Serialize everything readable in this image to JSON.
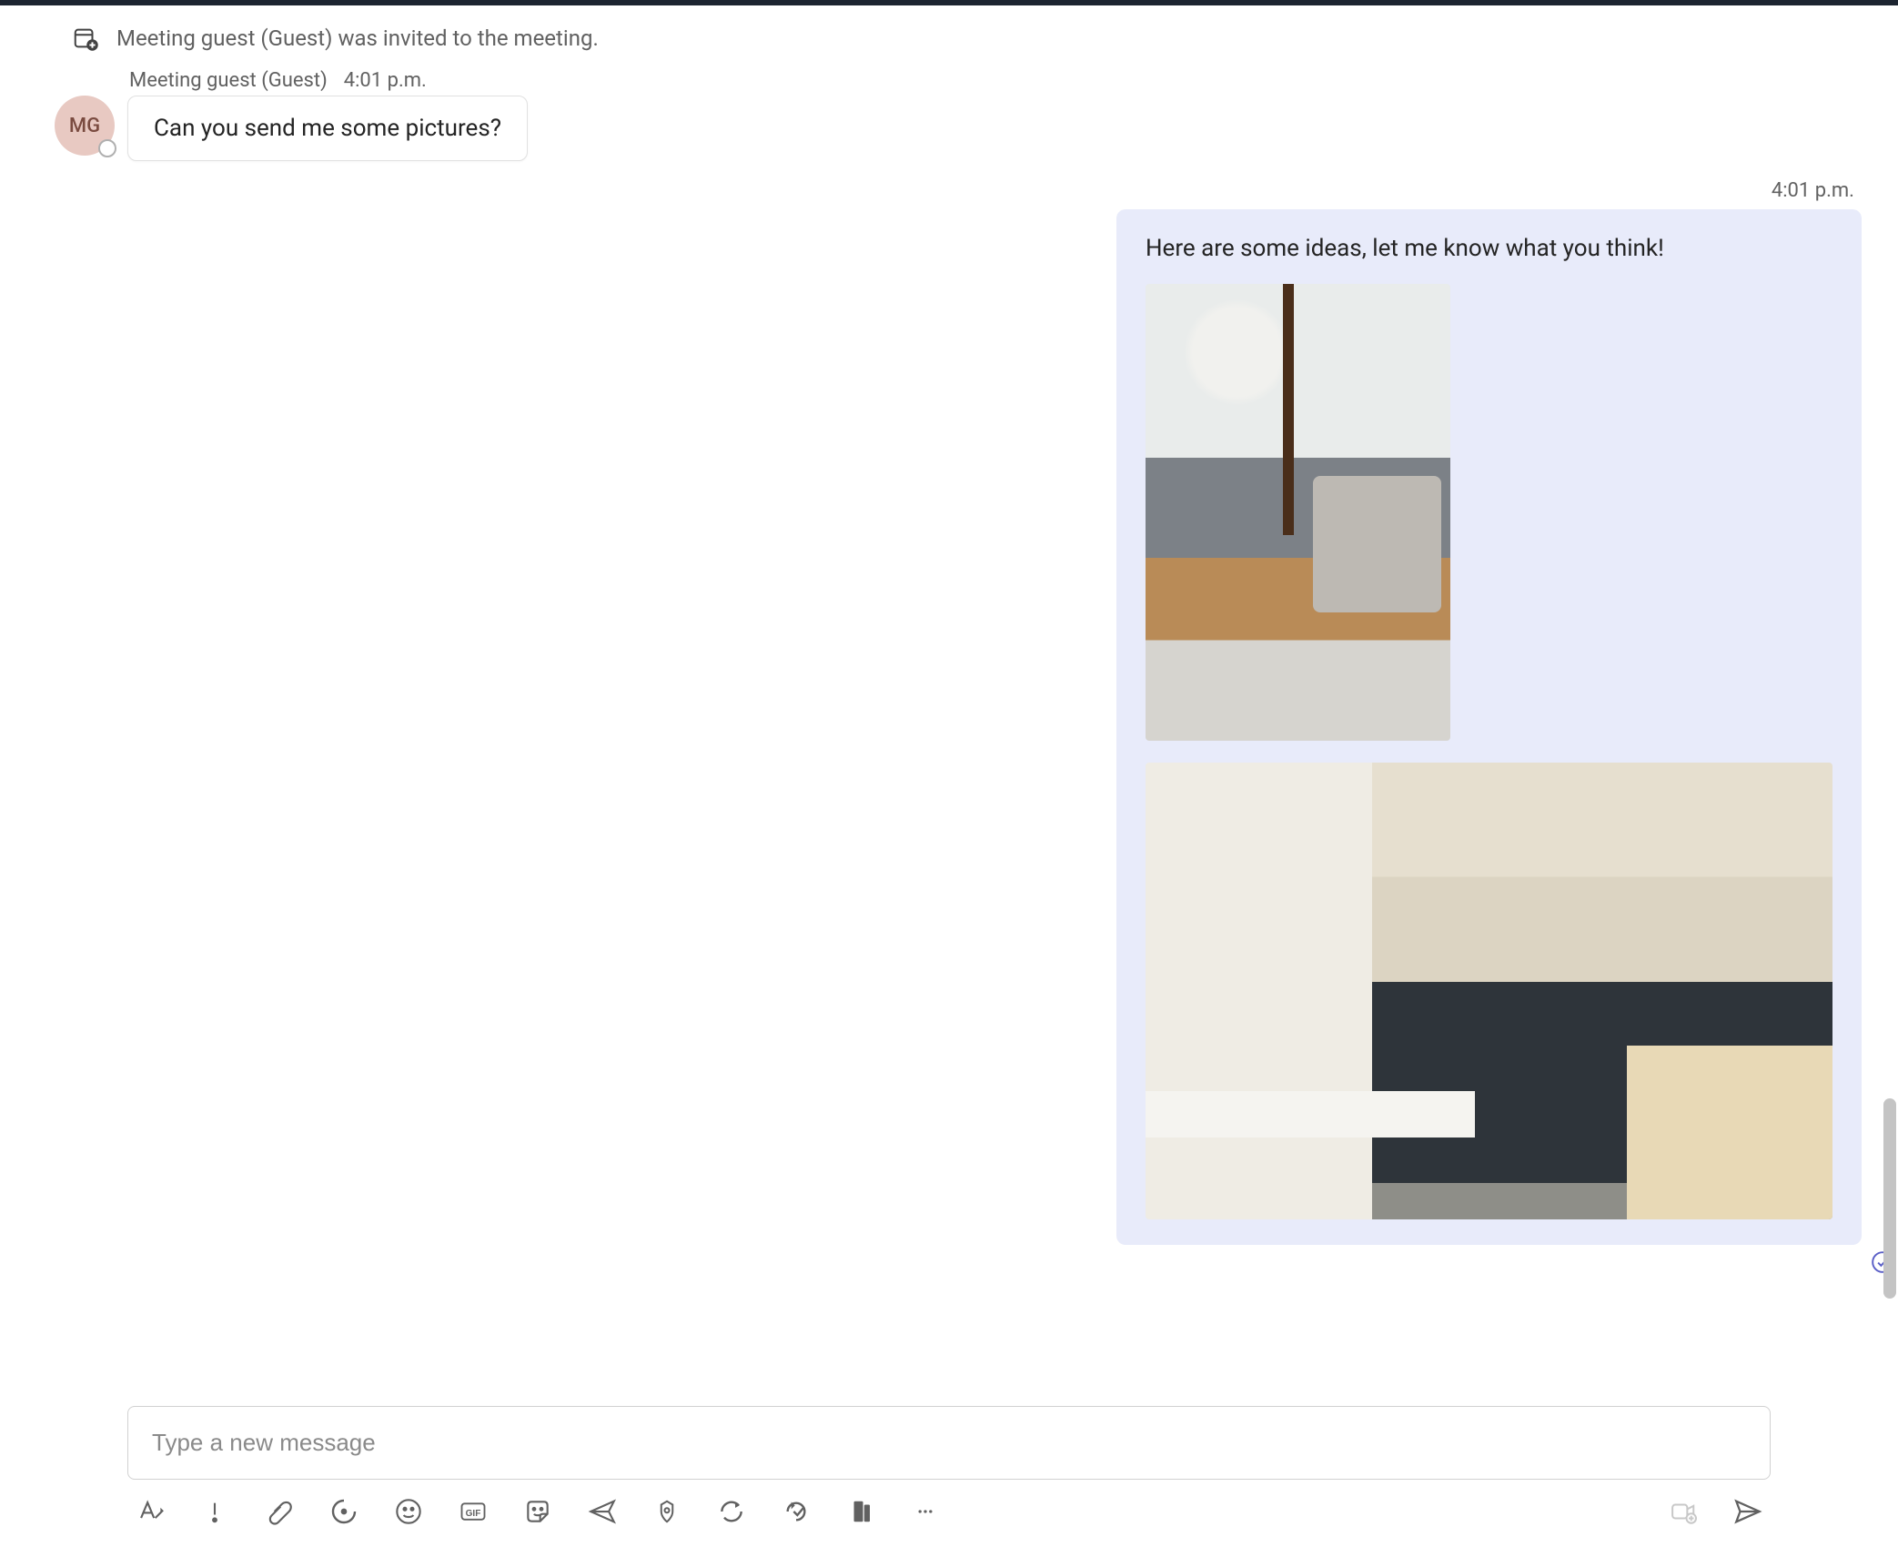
{
  "system_event": {
    "text": "Meeting guest (Guest) was invited to the meeting."
  },
  "received": {
    "sender_name": "Meeting guest (Guest)",
    "time": "4:01 p.m.",
    "avatar_initials": "MG",
    "text": "Can you send me some pictures?"
  },
  "sent": {
    "time": "4:01 p.m.",
    "text": "Here are some ideas, let me know what you think!",
    "images": [
      {
        "alt": "living-room-interior",
        "shape": "portrait"
      },
      {
        "alt": "modern-kitchen-interior",
        "shape": "landscape"
      }
    ]
  },
  "compose": {
    "placeholder": "Type a new message"
  },
  "toolbar_icons": {
    "format": "format-icon",
    "priority": "priority-icon",
    "attach": "attach-icon",
    "loop": "loop-icon",
    "emoji": "emoji-icon",
    "gif": "gif-icon",
    "sticker": "sticker-icon",
    "share": "share-plane-icon",
    "approvals": "approvals-icon",
    "updates": "updates-icon",
    "viva": "viva-icon",
    "actions": "actions-icon",
    "more": "more-icon",
    "video": "video-clip-icon",
    "send": "send-icon"
  }
}
